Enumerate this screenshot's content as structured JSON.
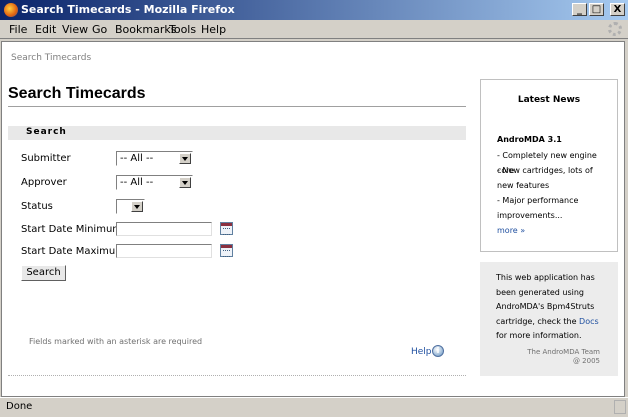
{
  "window": {
    "title": "Search Timecards - Mozilla Firefox",
    "buttons": [
      "_",
      "□",
      "X"
    ]
  },
  "menubar": {
    "items": [
      "File",
      "Edit",
      "View",
      "Go",
      "Bookmarks",
      "Tools",
      "Help"
    ]
  },
  "page": {
    "breadcrumb": "Search Timecards",
    "title": "Search Timecards",
    "section_title": "Search",
    "fields": {
      "submitter": {
        "label": "Submitter",
        "value": "-- All --"
      },
      "approver": {
        "label": "Approver",
        "value": "-- All --"
      },
      "status": {
        "label": "Status",
        "value": ""
      },
      "start_min": {
        "label": "Start Date Minimum",
        "value": ""
      },
      "start_max": {
        "label": "Start Date Maximum",
        "value": ""
      }
    },
    "search_button": "Search",
    "required_note": "Fields marked with an asterisk are required",
    "help_link": "Help"
  },
  "sidebar": {
    "news": {
      "title": "Latest News",
      "headline": "AndroMDA 3.1",
      "items": [
        "- Completely new engine core",
        "- New cartridges, lots of new features",
        "- Major performance improvements..."
      ],
      "more": "more »"
    },
    "info": {
      "text_before": "This web application has been generated using AndroMDA's Bpm4Struts cartridge, check the ",
      "docs_link": "Docs",
      "text_after": " for more information.",
      "team": "The AndroMDA Team",
      "year": "@ 2005"
    }
  },
  "statusbar": {
    "text": "Done"
  }
}
